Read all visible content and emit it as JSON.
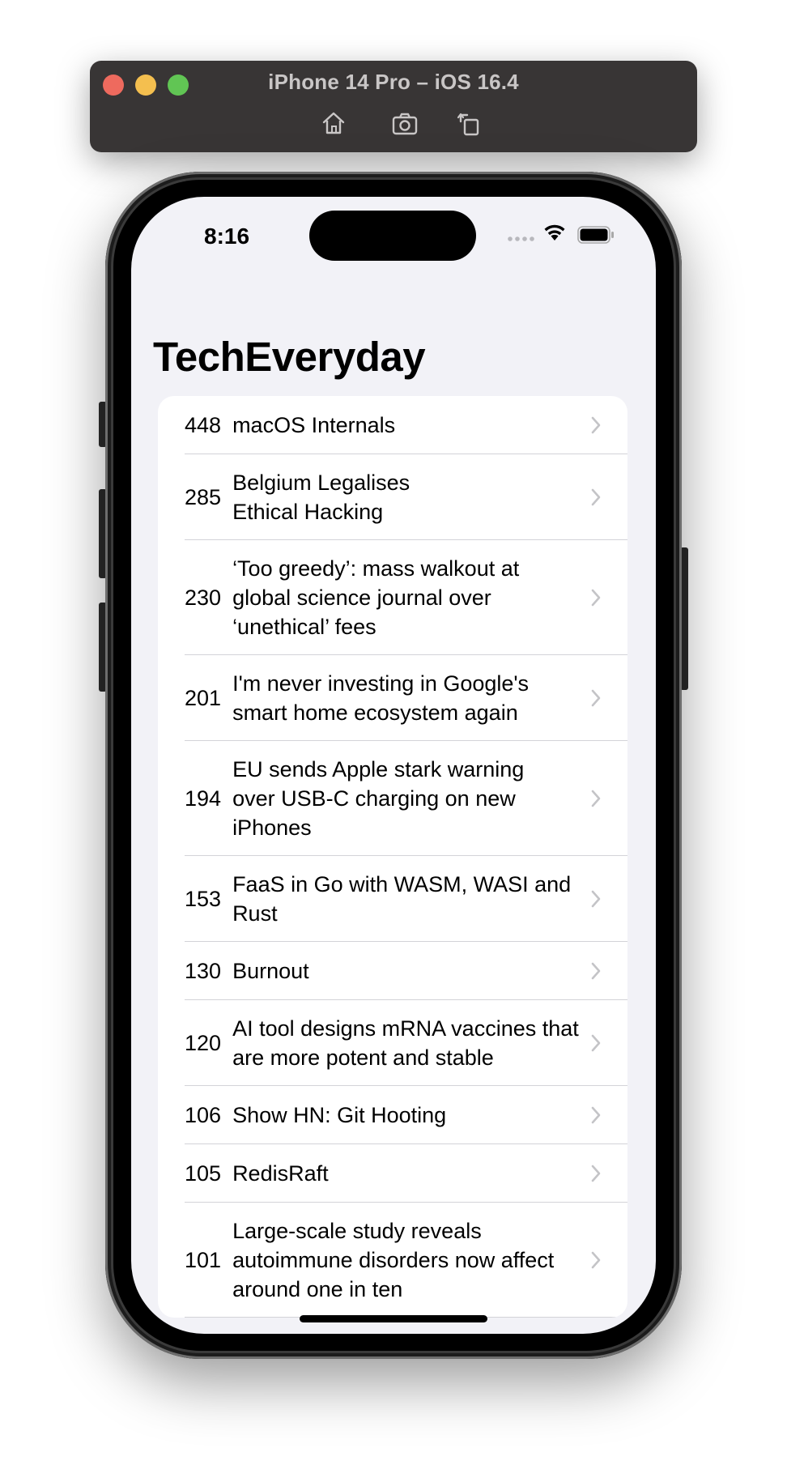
{
  "simulator": {
    "title": "iPhone 14 Pro – iOS 16.4",
    "tools": [
      "home-icon",
      "screenshot-icon",
      "rotate-icon"
    ]
  },
  "status_bar": {
    "time": "8:16",
    "icons": [
      "signal-icon",
      "wifi-icon",
      "battery-icon"
    ]
  },
  "nav": {
    "title": "TechEveryday"
  },
  "stories": [
    {
      "score": "448",
      "title": "macOS Internals"
    },
    {
      "score": "285",
      "title": "Belgium Legalises Ethical Hacking"
    },
    {
      "score": "230",
      "title": "‘Too greedy’: mass walkout at global science journal over ‘unethical’ fees"
    },
    {
      "score": "201",
      "title": "I'm never investing in Google's smart home ecosystem again"
    },
    {
      "score": "194",
      "title": "EU sends Apple stark warning over USB-C charging on new iPhones"
    },
    {
      "score": "153",
      "title": "FaaS in Go with WASM, WASI and Rust"
    },
    {
      "score": "130",
      "title": "Burnout"
    },
    {
      "score": "120",
      "title": "AI tool designs mRNA vaccines that are more potent and stable"
    },
    {
      "score": "106",
      "title": "Show HN: Git Hooting"
    },
    {
      "score": "105",
      "title": "RedisRaft"
    },
    {
      "score": "101",
      "title": "Large-scale study reveals autoimmune disorders now affect around one in ten"
    }
  ],
  "colors": {
    "screen_bg": "#f2f2f7",
    "chevron": "#c4c4c7",
    "traffic_red": "#ee6a5e",
    "traffic_yellow": "#f4bf4f",
    "traffic_green": "#61c554"
  }
}
